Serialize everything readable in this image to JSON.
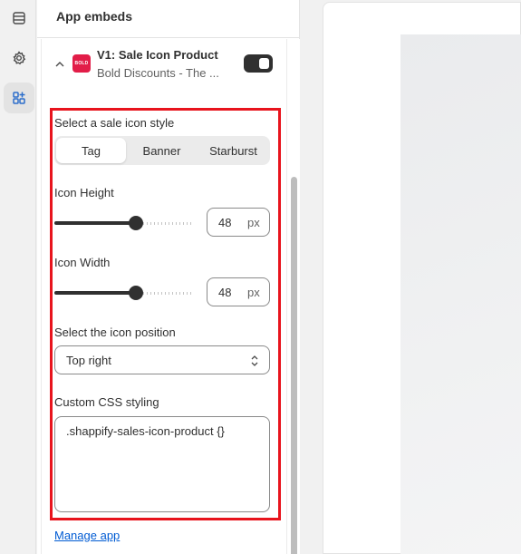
{
  "rail": {
    "items": [
      {
        "icon": "sections-icon",
        "active": false
      },
      {
        "icon": "gear-icon",
        "active": false
      },
      {
        "icon": "apps-icon",
        "active": true
      }
    ]
  },
  "panel": {
    "title": "App embeds"
  },
  "embed": {
    "icon_text": "BOLD",
    "title": "V1: Sale Icon Product",
    "subtitle": "Bold Discounts - The ...",
    "enabled": true,
    "accent_color": "#e21d48"
  },
  "settings": {
    "style_label": "Select a sale icon style",
    "style_options": [
      "Tag",
      "Banner",
      "Starburst"
    ],
    "style_selected": "Tag",
    "height_label": "Icon Height",
    "height_value": "48",
    "height_unit": "px",
    "width_label": "Icon Width",
    "width_value": "48",
    "width_unit": "px",
    "position_label": "Select the icon position",
    "position_value": "Top right",
    "css_label": "Custom CSS styling",
    "css_value": ".shappify-sales-icon-product {}",
    "highlight_color": "#e8141d"
  },
  "footer": {
    "manage_link": "Manage app"
  }
}
